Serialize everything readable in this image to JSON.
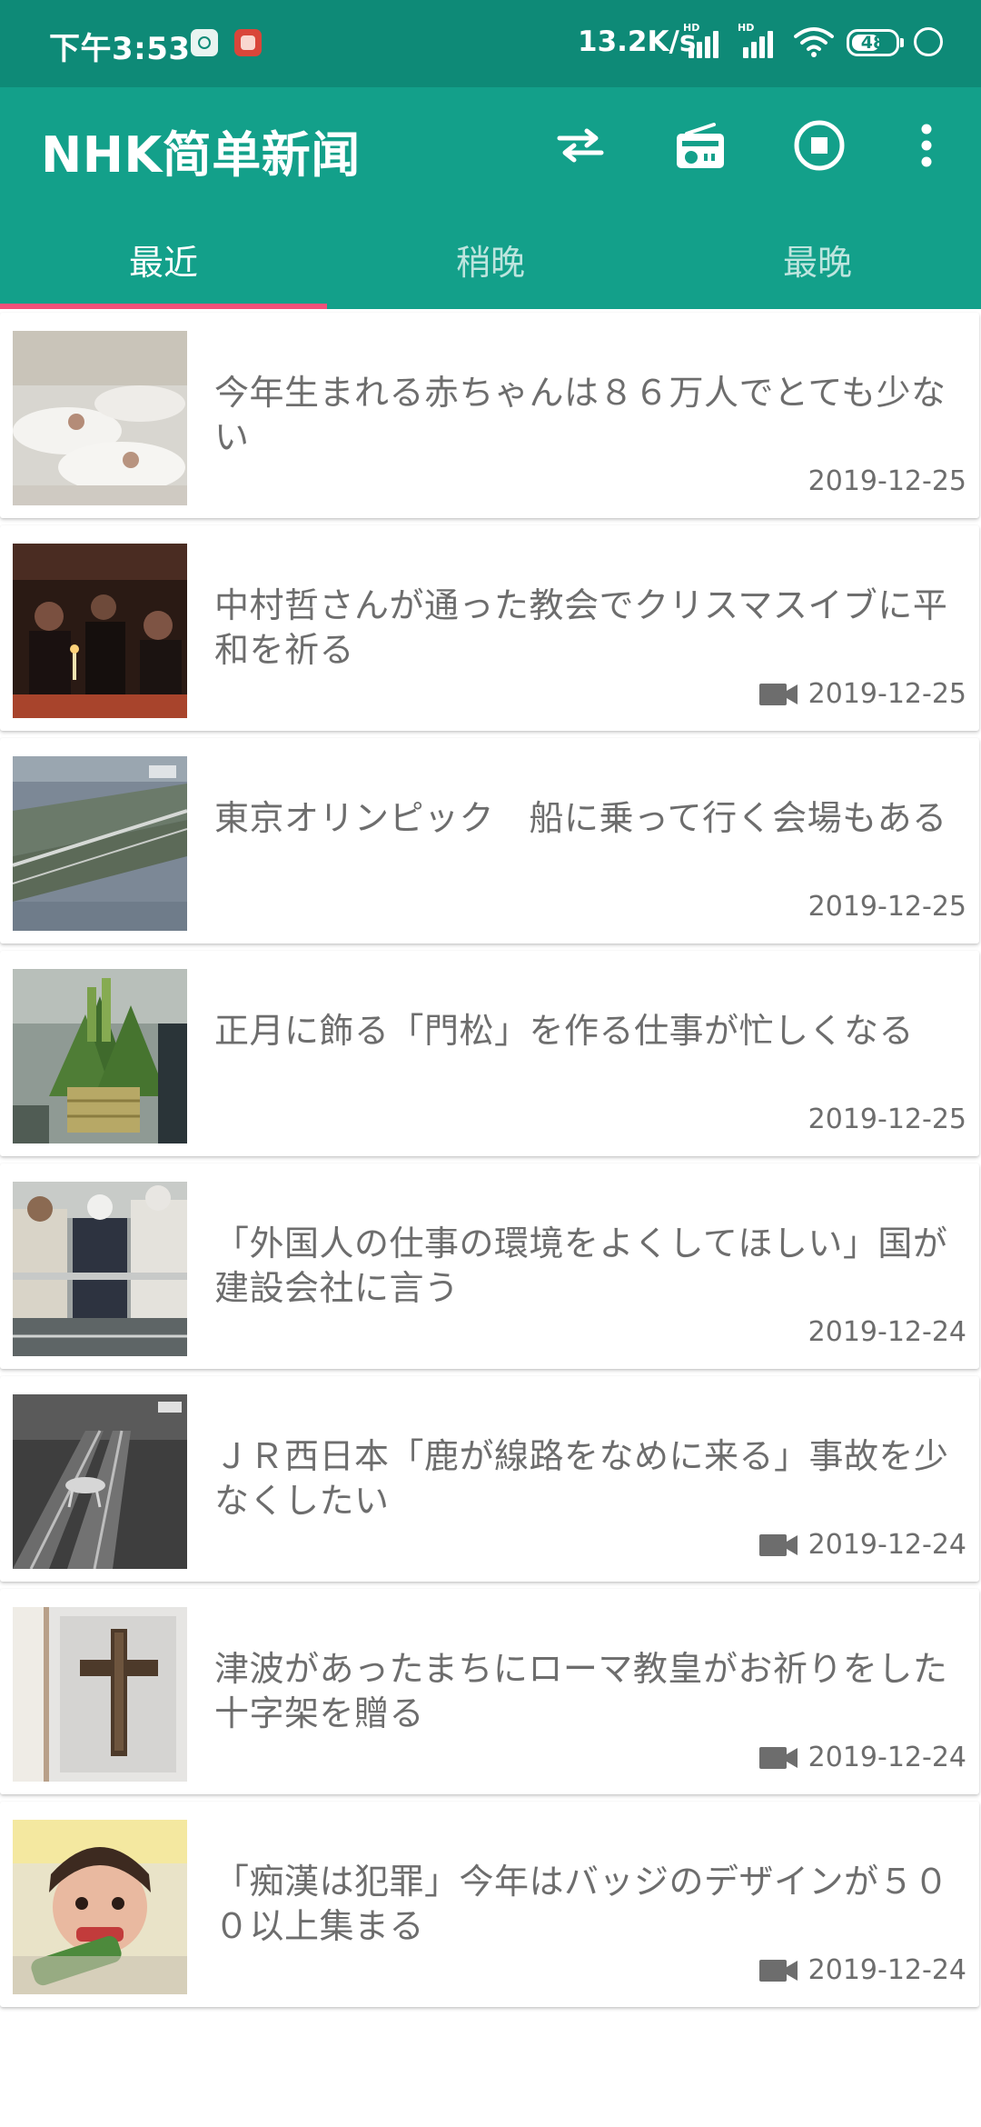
{
  "status_bar": {
    "time": "下午3:53",
    "network_speed": "13.2K/s",
    "signal_badge": "HD",
    "battery_level": "48"
  },
  "app_bar": {
    "title": "NHK简单新闻"
  },
  "tabs": [
    {
      "label": "最近",
      "active": true
    },
    {
      "label": "稍晚",
      "active": false
    },
    {
      "label": "最晚",
      "active": false
    }
  ],
  "articles": [
    {
      "title": "今年生まれる赤ちゃんは８６万人でとても少ない",
      "date": "2019-12-25",
      "has_video": false,
      "thumbnail": "hospital-nursery-photo"
    },
    {
      "title": "中村哲さんが通った教会でクリスマスイブに平和を祈る",
      "date": "2019-12-25",
      "has_video": true,
      "thumbnail": "church-candle-prayer-photo"
    },
    {
      "title": "東京オリンピック　船に乗って行く会場もある",
      "date": "2019-12-25",
      "has_video": false,
      "thumbnail": "aerial-waterfront-photo"
    },
    {
      "title": "正月に飾る「門松」を作る仕事が忙しくなる",
      "date": "2019-12-25",
      "has_video": false,
      "thumbnail": "kadomatsu-bamboo-photo"
    },
    {
      "title": "「外国人の仕事の環境をよくしてほしい」国が建設会社に言う",
      "date": "2019-12-24",
      "has_video": false,
      "thumbnail": "construction-workers-photo"
    },
    {
      "title": "ＪＲ西日本「鹿が線路をなめに来る」事故を少なくしたい",
      "date": "2019-12-24",
      "has_video": true,
      "thumbnail": "deer-on-railway-photo"
    },
    {
      "title": "津波があったまちにローマ教皇がお祈りをした十字架を贈る",
      "date": "2019-12-24",
      "has_video": true,
      "thumbnail": "wooden-cross-photo"
    },
    {
      "title": "「痴漢は犯罪」今年はバッジのデザインが５００以上集まる",
      "date": "2019-12-24",
      "has_video": true,
      "thumbnail": "badge-design-artwork"
    }
  ],
  "colors": {
    "status_bar": "#0e8a77",
    "app_bar": "#13a08a",
    "tab_indicator": "#f2507a",
    "text": "#6d6d6d"
  }
}
